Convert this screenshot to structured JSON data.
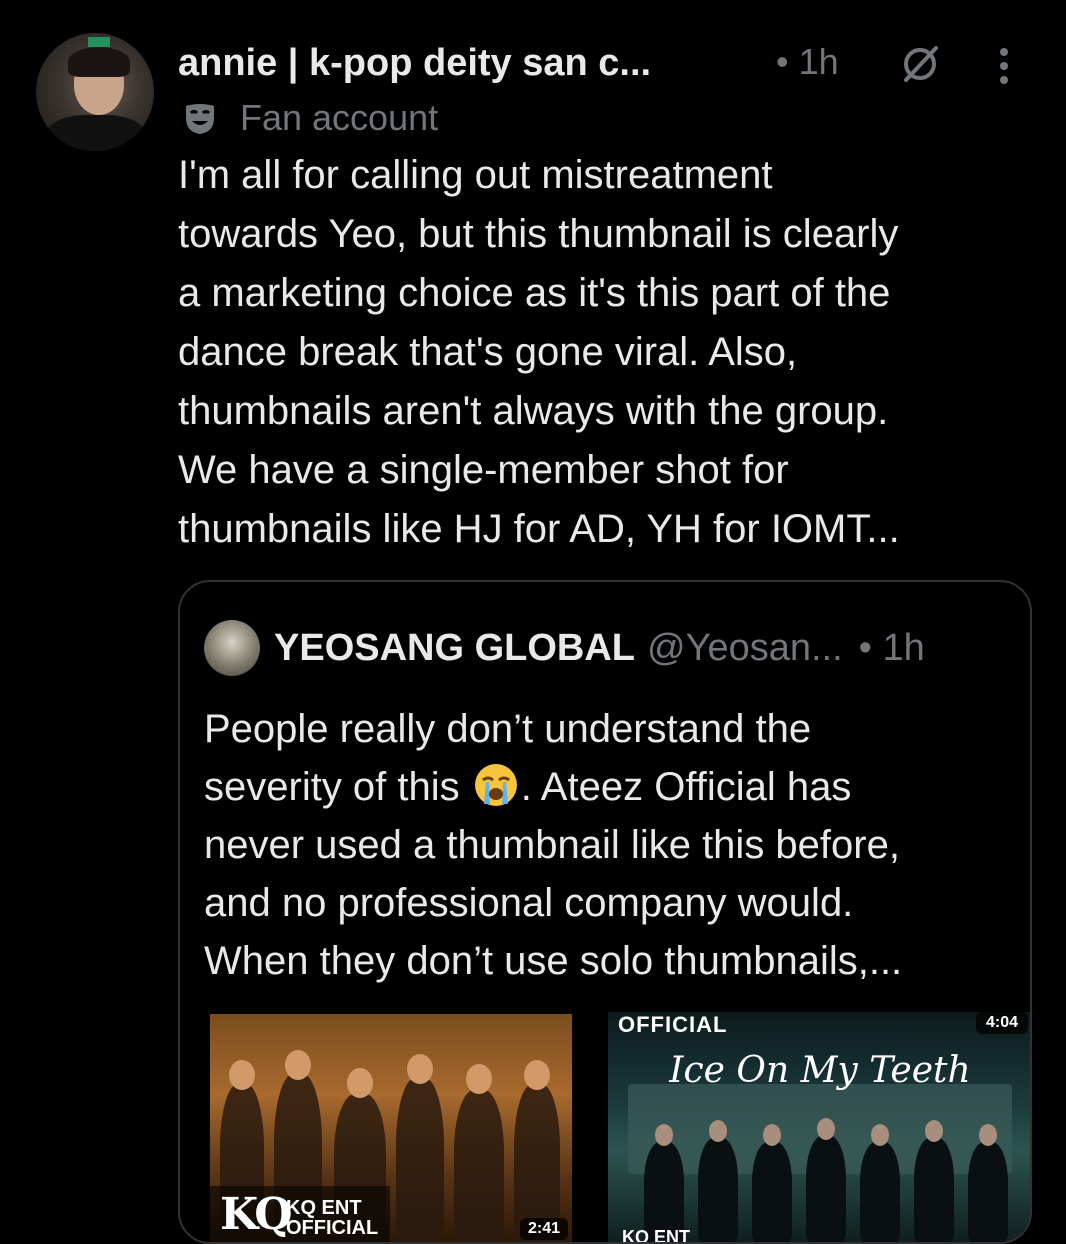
{
  "post": {
    "display_name": "annie | k-pop deity san c...",
    "time": "• 1h",
    "badge": "Fan account",
    "text": "I'm all for calling out mistreatment\ntowards Yeo, but this thumbnail is clearly\na marketing choice as it's this part of the\ndance break that's gone viral. Also,\nthumbnails aren't always with the group.\nWe have a single-member shot for\nthumbnails like HJ for AD, YH for IOMT...",
    "icons": [
      "grok-icon",
      "more-vertical-icon",
      "mask-icon"
    ]
  },
  "quote": {
    "name": "YEOSANG GLOBAL",
    "handle": "@Yeosan...",
    "time": "• 1h",
    "text_before_emoji": "People really don’t understand the\nseverity of this",
    "emoji": "loudly-crying-face",
    "text_after_emoji": ". Ateez Official has\nnever used a thumbnail like this before,\nand no professional company would.\nWhen they don’t use solo thumbnails,...",
    "thumbnails": [
      {
        "logo": "KQ",
        "logo_text": "KQ ENT\nOFFICIAL",
        "duration": "2:41"
      },
      {
        "top_label": "OFFICIAL",
        "title": "Ice On My Teeth",
        "duration": "4:04",
        "bottom_label": "KQ ENT"
      }
    ]
  },
  "colors": {
    "background": "#000000",
    "text_primary": "#e7e9ea",
    "text_secondary": "#71767b",
    "border": "#2f3336"
  }
}
